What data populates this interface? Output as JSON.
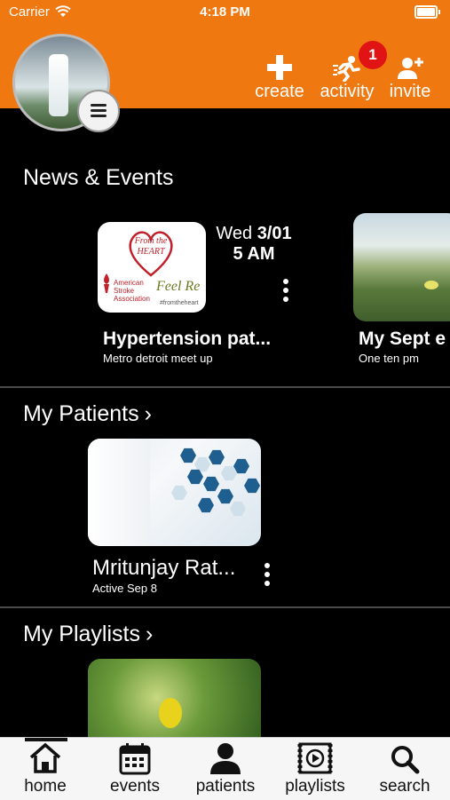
{
  "status_bar": {
    "carrier": "Carrier",
    "time": "4:18 PM"
  },
  "header": {
    "buttons": [
      {
        "label": "create",
        "icon": "plus-icon"
      },
      {
        "label": "activity",
        "icon": "running-person-icon"
      },
      {
        "label": "invite",
        "icon": "add-person-icon"
      }
    ],
    "activity_badge": "1"
  },
  "news": {
    "title": "News & Events",
    "events": [
      {
        "day": "Wed",
        "date": "3/01",
        "time": "5 AM",
        "title": "Hypertension pat...",
        "subtitle": "Metro detroit meet up",
        "image_text": {
          "script": "From the HEART",
          "org": "American Stroke Association",
          "sign": "Feel Re",
          "tag": "#fromtheheart"
        }
      },
      {
        "title": "My Sept e",
        "subtitle": "One ten pm"
      }
    ]
  },
  "patients": {
    "title": "My Patients",
    "items": [
      {
        "name": "Mritunjay Rat...",
        "status": "Active Sep 8"
      }
    ]
  },
  "playlists": {
    "title": "My Playlists"
  },
  "tabs": [
    {
      "label": "home",
      "icon": "home-icon"
    },
    {
      "label": "events",
      "icon": "calendar-icon"
    },
    {
      "label": "patients",
      "icon": "person-icon"
    },
    {
      "label": "playlists",
      "icon": "playlist-icon"
    },
    {
      "label": "search",
      "icon": "search-icon"
    }
  ],
  "colors": {
    "header": "#f07810",
    "badge": "#e01414",
    "background": "#000000"
  }
}
